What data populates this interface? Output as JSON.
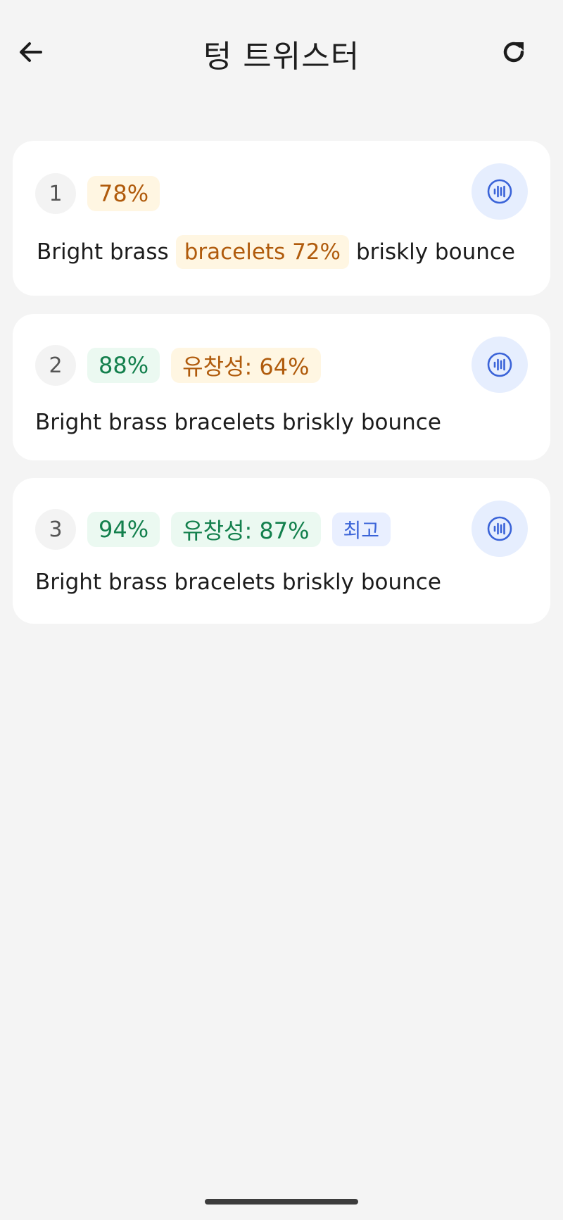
{
  "header": {
    "title": "텅 트위스터",
    "back_icon": "arrow-left-icon",
    "refresh_icon": "refresh-icon"
  },
  "attempts": [
    {
      "number": "1",
      "score": "78%",
      "sentence_before": "Bright brass",
      "highlighted_word": "bracelets 72%",
      "sentence_after": "briskly bounce"
    },
    {
      "number": "2",
      "score": "88%",
      "fluency": "유창성: 64%",
      "sentence": "Bright brass bracelets briskly bounce"
    },
    {
      "number": "3",
      "score": "94%",
      "fluency": "유창성: 87%",
      "best_label": "최고",
      "sentence": "Bright brass bracelets briskly bounce"
    }
  ],
  "colors": {
    "background": "#f4f4f4",
    "card": "#ffffff",
    "warning_text": "#b05b0c",
    "warning_bg": "#fff6e2",
    "good_text": "#13804d",
    "good_bg": "#ebf9f1",
    "accent_blue": "#3a63d8",
    "accent_blue_bg": "#e6eefe"
  },
  "play_icon": "audio-waveform-icon"
}
